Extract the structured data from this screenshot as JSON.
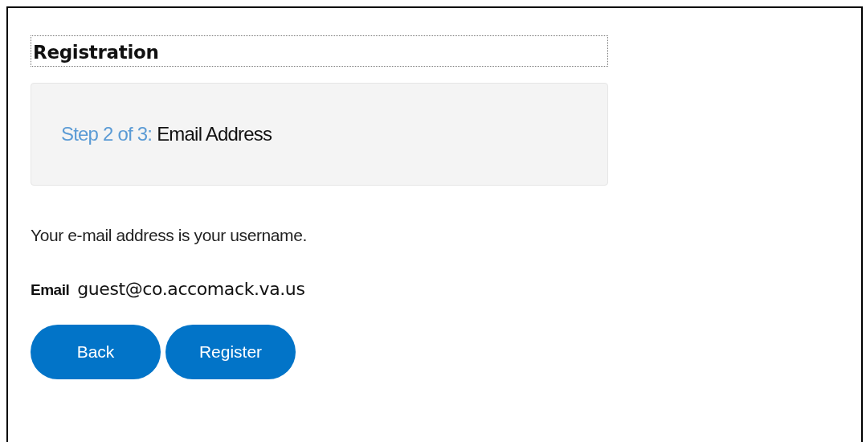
{
  "heading": "Registration",
  "step": {
    "label": "Step 2 of 3:",
    "title": "Email Address"
  },
  "note": "Your e-mail address is your username.",
  "email": {
    "label": "Email",
    "value": "guest@co.accomack.va.us"
  },
  "buttons": [
    "Back",
    "Register"
  ]
}
